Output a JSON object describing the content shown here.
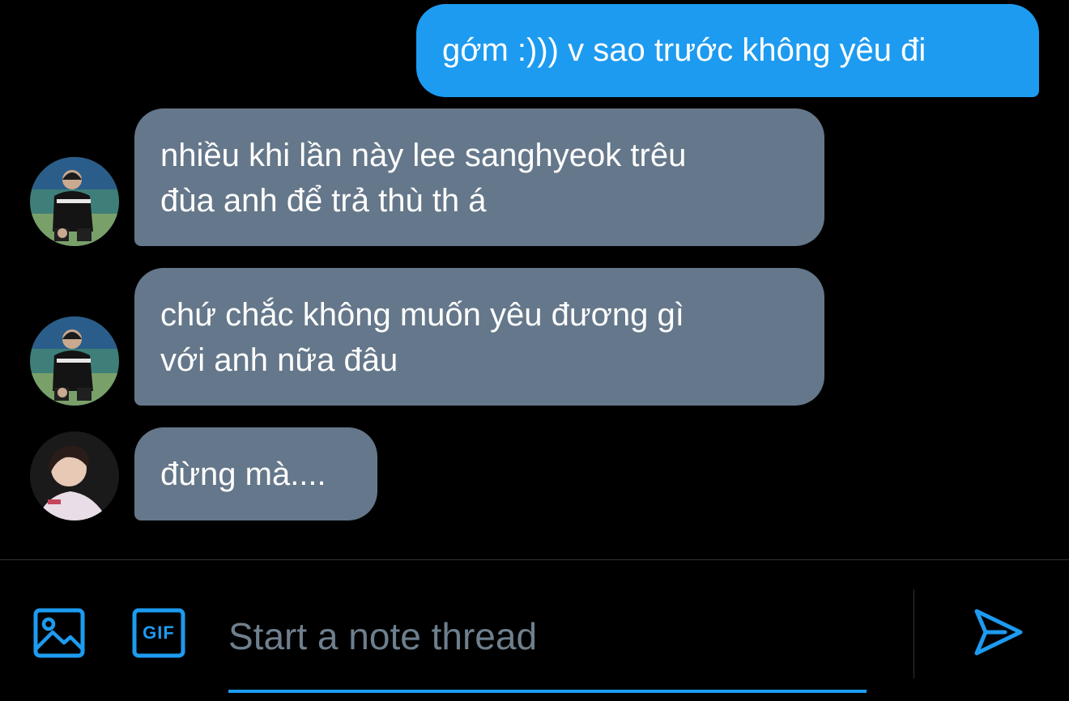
{
  "messages": [
    {
      "direction": "sent",
      "lines": [
        "gớm :))) v sao trước không yêu đi"
      ]
    },
    {
      "direction": "received",
      "avatar": "avatar-1",
      "lines": [
        "nhiều khi lần này lee sanghyeok trêu",
        "đùa anh để trả thù th á"
      ]
    },
    {
      "direction": "received",
      "avatar": "avatar-1",
      "lines": [
        "chứ chắc không muốn yêu đương gì",
        "với anh nữa đâu"
      ]
    },
    {
      "direction": "received",
      "avatar": "avatar-2",
      "lines": [
        "đừng mà...."
      ]
    }
  ],
  "composer": {
    "placeholder": "Start a note thread",
    "gif_label": "GIF",
    "icons": {
      "image": "image-icon",
      "gif": "gif-icon",
      "send": "send-icon"
    }
  },
  "colors": {
    "background": "#000000",
    "sent_bubble": "#1d9bf0",
    "received_bubble": "#65778a",
    "accent": "#1d9bf0",
    "placeholder": "#6e7f8d"
  }
}
